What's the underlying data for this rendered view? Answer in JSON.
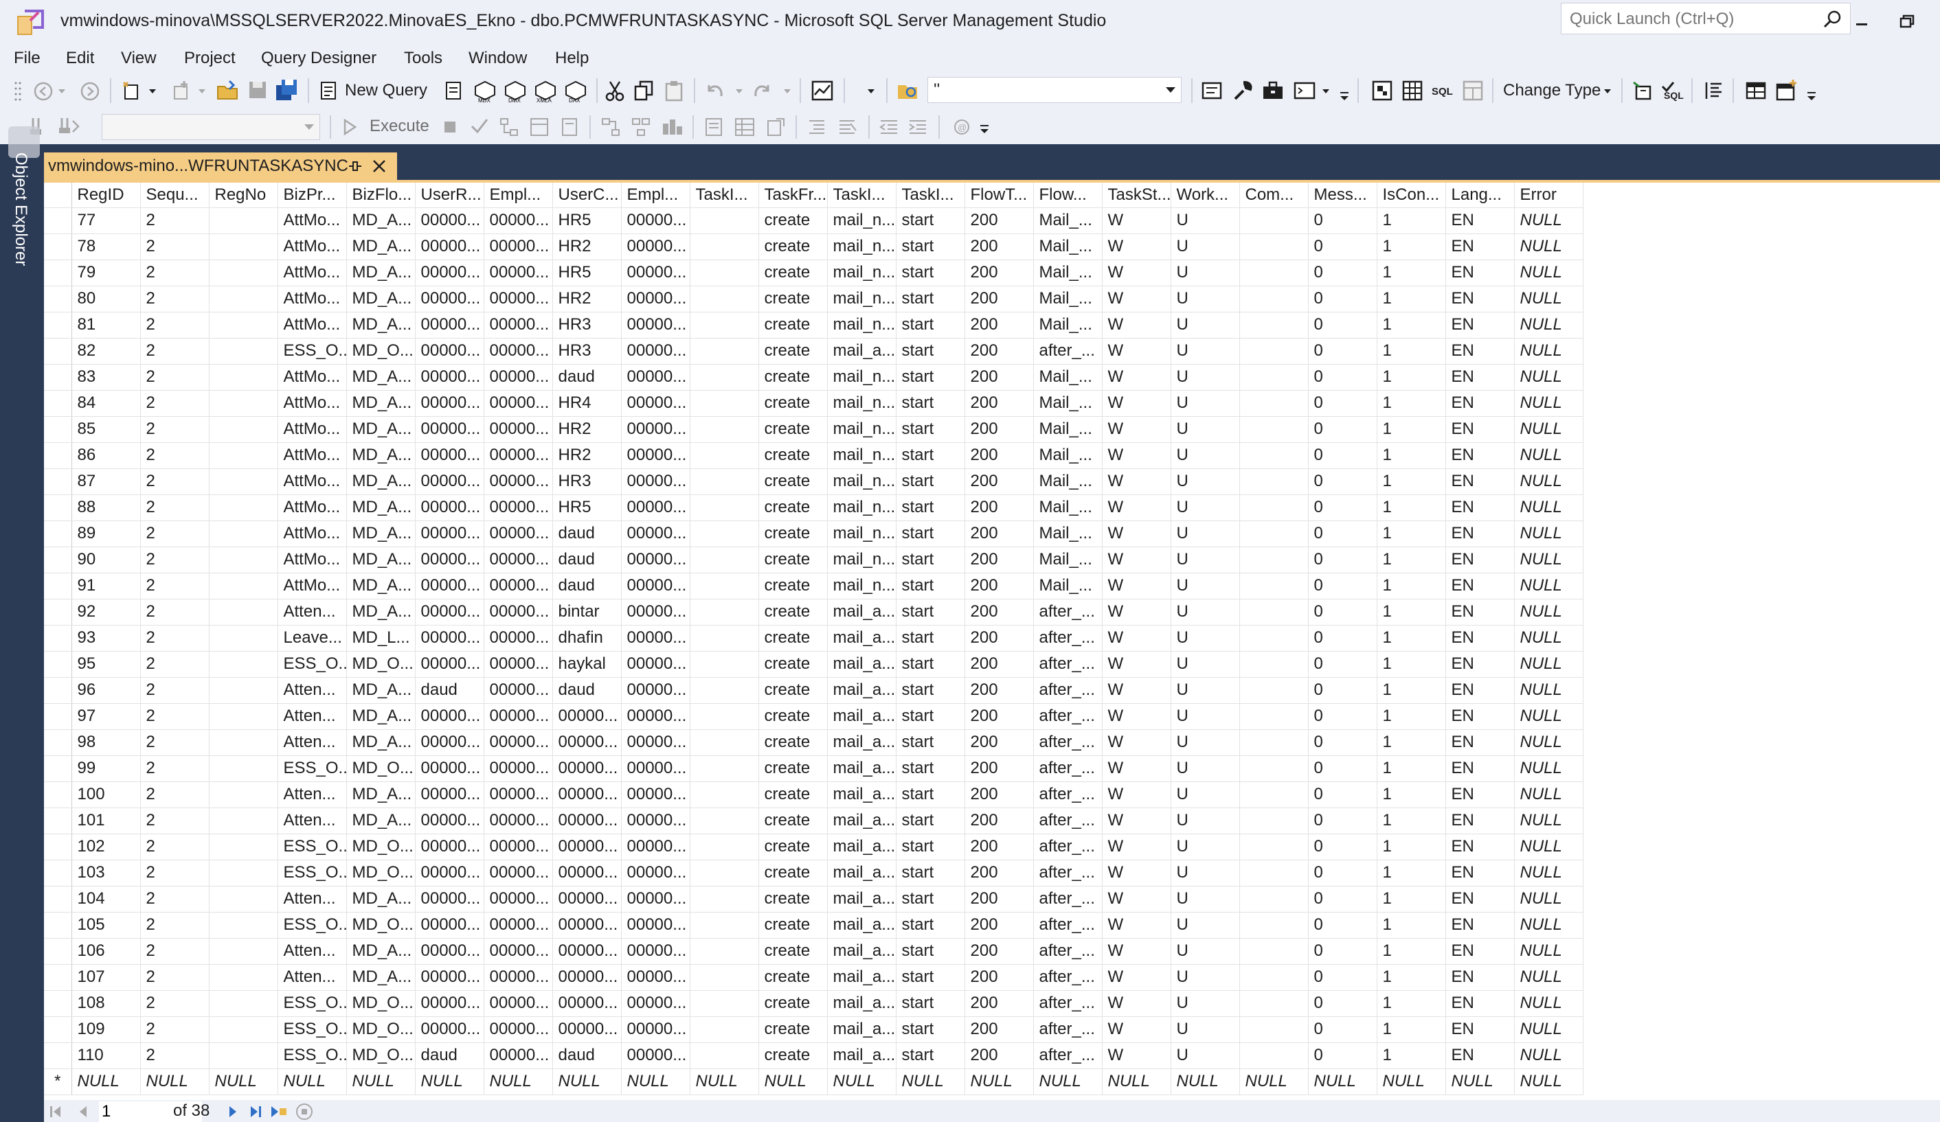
{
  "window": {
    "title": "vmwindows-minova\\MSSQLSERVER2022.MinovaES_Ekno - dbo.PCMWFRUNTASKASYNC - Microsoft SQL Server Management Studio",
    "quick_launch_placeholder": "Quick Launch (Ctrl+Q)"
  },
  "menu": [
    "File",
    "Edit",
    "View",
    "Project",
    "Query Designer",
    "Tools",
    "Window",
    "Help"
  ],
  "toolbar": {
    "new_query_label": "New Query",
    "database_combo_value": "''",
    "change_type_label": "Change Type",
    "execute_label": "Execute",
    "icons": [
      "back-icon",
      "forward-icon",
      "new-project-icon",
      "add-item-icon",
      "open-file-icon",
      "save-icon",
      "save-all-icon",
      "mdx-query-icon",
      "dmx-query-icon",
      "xmla-query-icon",
      "dax-query-icon",
      "cut-icon",
      "copy-icon",
      "paste-icon",
      "undo-icon",
      "redo-icon",
      "activity-monitor-icon",
      "find-icon",
      "properties-icon",
      "wrench-icon",
      "toolbox-icon",
      "show-diagram-pane-icon",
      "show-criteria-pane-icon",
      "show-sql-pane-icon",
      "show-results-pane-icon",
      "verify-sql-icon",
      "add-group-by-icon",
      "add-table-icon",
      "add-derived-table-icon"
    ]
  },
  "side_panel": {
    "label": "Object Explorer"
  },
  "tab": {
    "label": "vmwindows-mino...WFRUNTASKASYNC"
  },
  "grid": {
    "columns": [
      "RegID",
      "Sequ...",
      "RegNo",
      "BizPr...",
      "BizFlo...",
      "UserR...",
      "Empl...",
      "UserC...",
      "Empl...",
      "TaskI...",
      "TaskFr...",
      "TaskI...",
      "TaskI...",
      "FlowT...",
      "Flow...",
      "TaskSt...",
      "Work...",
      "Com...",
      "Mess...",
      "IsCon...",
      "Lang...",
      "Error"
    ],
    "rows": [
      [
        "77",
        "2",
        "",
        "AttMo...",
        "MD_A...",
        "00000...",
        "00000...",
        "HR5",
        "00000...",
        "",
        "create",
        "mail_n...",
        "start",
        "200",
        "Mail_...",
        "W",
        "U",
        "",
        "0",
        "1",
        "EN",
        "NULL"
      ],
      [
        "78",
        "2",
        "",
        "AttMo...",
        "MD_A...",
        "00000...",
        "00000...",
        "HR2",
        "00000...",
        "",
        "create",
        "mail_n...",
        "start",
        "200",
        "Mail_...",
        "W",
        "U",
        "",
        "0",
        "1",
        "EN",
        "NULL"
      ],
      [
        "79",
        "2",
        "",
        "AttMo...",
        "MD_A...",
        "00000...",
        "00000...",
        "HR5",
        "00000...",
        "",
        "create",
        "mail_n...",
        "start",
        "200",
        "Mail_...",
        "W",
        "U",
        "",
        "0",
        "1",
        "EN",
        "NULL"
      ],
      [
        "80",
        "2",
        "",
        "AttMo...",
        "MD_A...",
        "00000...",
        "00000...",
        "HR2",
        "00000...",
        "",
        "create",
        "mail_n...",
        "start",
        "200",
        "Mail_...",
        "W",
        "U",
        "",
        "0",
        "1",
        "EN",
        "NULL"
      ],
      [
        "81",
        "2",
        "",
        "AttMo...",
        "MD_A...",
        "00000...",
        "00000...",
        "HR3",
        "00000...",
        "",
        "create",
        "mail_n...",
        "start",
        "200",
        "Mail_...",
        "W",
        "U",
        "",
        "0",
        "1",
        "EN",
        "NULL"
      ],
      [
        "82",
        "2",
        "",
        "ESS_O...",
        "MD_O...",
        "00000...",
        "00000...",
        "HR3",
        "00000...",
        "",
        "create",
        "mail_a...",
        "start",
        "200",
        "after_...",
        "W",
        "U",
        "",
        "0",
        "1",
        "EN",
        "NULL"
      ],
      [
        "83",
        "2",
        "",
        "AttMo...",
        "MD_A...",
        "00000...",
        "00000...",
        "daud",
        "00000...",
        "",
        "create",
        "mail_n...",
        "start",
        "200",
        "Mail_...",
        "W",
        "U",
        "",
        "0",
        "1",
        "EN",
        "NULL"
      ],
      [
        "84",
        "2",
        "",
        "AttMo...",
        "MD_A...",
        "00000...",
        "00000...",
        "HR4",
        "00000...",
        "",
        "create",
        "mail_n...",
        "start",
        "200",
        "Mail_...",
        "W",
        "U",
        "",
        "0",
        "1",
        "EN",
        "NULL"
      ],
      [
        "85",
        "2",
        "",
        "AttMo...",
        "MD_A...",
        "00000...",
        "00000...",
        "HR2",
        "00000...",
        "",
        "create",
        "mail_n...",
        "start",
        "200",
        "Mail_...",
        "W",
        "U",
        "",
        "0",
        "1",
        "EN",
        "NULL"
      ],
      [
        "86",
        "2",
        "",
        "AttMo...",
        "MD_A...",
        "00000...",
        "00000...",
        "HR2",
        "00000...",
        "",
        "create",
        "mail_n...",
        "start",
        "200",
        "Mail_...",
        "W",
        "U",
        "",
        "0",
        "1",
        "EN",
        "NULL"
      ],
      [
        "87",
        "2",
        "",
        "AttMo...",
        "MD_A...",
        "00000...",
        "00000...",
        "HR3",
        "00000...",
        "",
        "create",
        "mail_n...",
        "start",
        "200",
        "Mail_...",
        "W",
        "U",
        "",
        "0",
        "1",
        "EN",
        "NULL"
      ],
      [
        "88",
        "2",
        "",
        "AttMo...",
        "MD_A...",
        "00000...",
        "00000...",
        "HR5",
        "00000...",
        "",
        "create",
        "mail_n...",
        "start",
        "200",
        "Mail_...",
        "W",
        "U",
        "",
        "0",
        "1",
        "EN",
        "NULL"
      ],
      [
        "89",
        "2",
        "",
        "AttMo...",
        "MD_A...",
        "00000...",
        "00000...",
        "daud",
        "00000...",
        "",
        "create",
        "mail_n...",
        "start",
        "200",
        "Mail_...",
        "W",
        "U",
        "",
        "0",
        "1",
        "EN",
        "NULL"
      ],
      [
        "90",
        "2",
        "",
        "AttMo...",
        "MD_A...",
        "00000...",
        "00000...",
        "daud",
        "00000...",
        "",
        "create",
        "mail_n...",
        "start",
        "200",
        "Mail_...",
        "W",
        "U",
        "",
        "0",
        "1",
        "EN",
        "NULL"
      ],
      [
        "91",
        "2",
        "",
        "AttMo...",
        "MD_A...",
        "00000...",
        "00000...",
        "daud",
        "00000...",
        "",
        "create",
        "mail_n...",
        "start",
        "200",
        "Mail_...",
        "W",
        "U",
        "",
        "0",
        "1",
        "EN",
        "NULL"
      ],
      [
        "92",
        "2",
        "",
        "Atten...",
        "MD_A...",
        "00000...",
        "00000...",
        "bintar",
        "00000...",
        "",
        "create",
        "mail_a...",
        "start",
        "200",
        "after_...",
        "W",
        "U",
        "",
        "0",
        "1",
        "EN",
        "NULL"
      ],
      [
        "93",
        "2",
        "",
        "Leave...",
        "MD_L...",
        "00000...",
        "00000...",
        "dhafin",
        "00000...",
        "",
        "create",
        "mail_a...",
        "start",
        "200",
        "after_...",
        "W",
        "U",
        "",
        "0",
        "1",
        "EN",
        "NULL"
      ],
      [
        "95",
        "2",
        "",
        "ESS_O...",
        "MD_O...",
        "00000...",
        "00000...",
        "haykal",
        "00000...",
        "",
        "create",
        "mail_a...",
        "start",
        "200",
        "after_...",
        "W",
        "U",
        "",
        "0",
        "1",
        "EN",
        "NULL"
      ],
      [
        "96",
        "2",
        "",
        "Atten...",
        "MD_A...",
        "daud",
        "00000...",
        "daud",
        "00000...",
        "",
        "create",
        "mail_a...",
        "start",
        "200",
        "after_...",
        "W",
        "U",
        "",
        "0",
        "1",
        "EN",
        "NULL"
      ],
      [
        "97",
        "2",
        "",
        "Atten...",
        "MD_A...",
        "00000...",
        "00000...",
        "00000...",
        "00000...",
        "",
        "create",
        "mail_a...",
        "start",
        "200",
        "after_...",
        "W",
        "U",
        "",
        "0",
        "1",
        "EN",
        "NULL"
      ],
      [
        "98",
        "2",
        "",
        "Atten...",
        "MD_A...",
        "00000...",
        "00000...",
        "00000...",
        "00000...",
        "",
        "create",
        "mail_a...",
        "start",
        "200",
        "after_...",
        "W",
        "U",
        "",
        "0",
        "1",
        "EN",
        "NULL"
      ],
      [
        "99",
        "2",
        "",
        "ESS_O...",
        "MD_O...",
        "00000...",
        "00000...",
        "00000...",
        "00000...",
        "",
        "create",
        "mail_a...",
        "start",
        "200",
        "after_...",
        "W",
        "U",
        "",
        "0",
        "1",
        "EN",
        "NULL"
      ],
      [
        "100",
        "2",
        "",
        "Atten...",
        "MD_A...",
        "00000...",
        "00000...",
        "00000...",
        "00000...",
        "",
        "create",
        "mail_a...",
        "start",
        "200",
        "after_...",
        "W",
        "U",
        "",
        "0",
        "1",
        "EN",
        "NULL"
      ],
      [
        "101",
        "2",
        "",
        "Atten...",
        "MD_A...",
        "00000...",
        "00000...",
        "00000...",
        "00000...",
        "",
        "create",
        "mail_a...",
        "start",
        "200",
        "after_...",
        "W",
        "U",
        "",
        "0",
        "1",
        "EN",
        "NULL"
      ],
      [
        "102",
        "2",
        "",
        "ESS_O...",
        "MD_O...",
        "00000...",
        "00000...",
        "00000...",
        "00000...",
        "",
        "create",
        "mail_a...",
        "start",
        "200",
        "after_...",
        "W",
        "U",
        "",
        "0",
        "1",
        "EN",
        "NULL"
      ],
      [
        "103",
        "2",
        "",
        "ESS_O...",
        "MD_O...",
        "00000...",
        "00000...",
        "00000...",
        "00000...",
        "",
        "create",
        "mail_a...",
        "start",
        "200",
        "after_...",
        "W",
        "U",
        "",
        "0",
        "1",
        "EN",
        "NULL"
      ],
      [
        "104",
        "2",
        "",
        "Atten...",
        "MD_A...",
        "00000...",
        "00000...",
        "00000...",
        "00000...",
        "",
        "create",
        "mail_a...",
        "start",
        "200",
        "after_...",
        "W",
        "U",
        "",
        "0",
        "1",
        "EN",
        "NULL"
      ],
      [
        "105",
        "2",
        "",
        "ESS_O...",
        "MD_O...",
        "00000...",
        "00000...",
        "00000...",
        "00000...",
        "",
        "create",
        "mail_a...",
        "start",
        "200",
        "after_...",
        "W",
        "U",
        "",
        "0",
        "1",
        "EN",
        "NULL"
      ],
      [
        "106",
        "2",
        "",
        "Atten...",
        "MD_A...",
        "00000...",
        "00000...",
        "00000...",
        "00000...",
        "",
        "create",
        "mail_a...",
        "start",
        "200",
        "after_...",
        "W",
        "U",
        "",
        "0",
        "1",
        "EN",
        "NULL"
      ],
      [
        "107",
        "2",
        "",
        "Atten...",
        "MD_A...",
        "00000...",
        "00000...",
        "00000...",
        "00000...",
        "",
        "create",
        "mail_a...",
        "start",
        "200",
        "after_...",
        "W",
        "U",
        "",
        "0",
        "1",
        "EN",
        "NULL"
      ],
      [
        "108",
        "2",
        "",
        "ESS_O...",
        "MD_O...",
        "00000...",
        "00000...",
        "00000...",
        "00000...",
        "",
        "create",
        "mail_a...",
        "start",
        "200",
        "after_...",
        "W",
        "U",
        "",
        "0",
        "1",
        "EN",
        "NULL"
      ],
      [
        "109",
        "2",
        "",
        "ESS_O...",
        "MD_O...",
        "00000...",
        "00000...",
        "00000...",
        "00000...",
        "",
        "create",
        "mail_a...",
        "start",
        "200",
        "after_...",
        "W",
        "U",
        "",
        "0",
        "1",
        "EN",
        "NULL"
      ],
      [
        "110",
        "2",
        "",
        "ESS_O...",
        "MD_O...",
        "daud",
        "00000...",
        "daud",
        "00000...",
        "",
        "create",
        "mail_a...",
        "start",
        "200",
        "after_...",
        "W",
        "U",
        "",
        "0",
        "1",
        "EN",
        "NULL"
      ]
    ],
    "new_row_marker": "*",
    "new_row_value": "NULL"
  },
  "pager": {
    "current_page": "1",
    "of_label": "of 38"
  },
  "colors": {
    "chrome": "#eef0f8",
    "dark_panel": "#2b3a55",
    "tab_active": "#f5cc84"
  }
}
